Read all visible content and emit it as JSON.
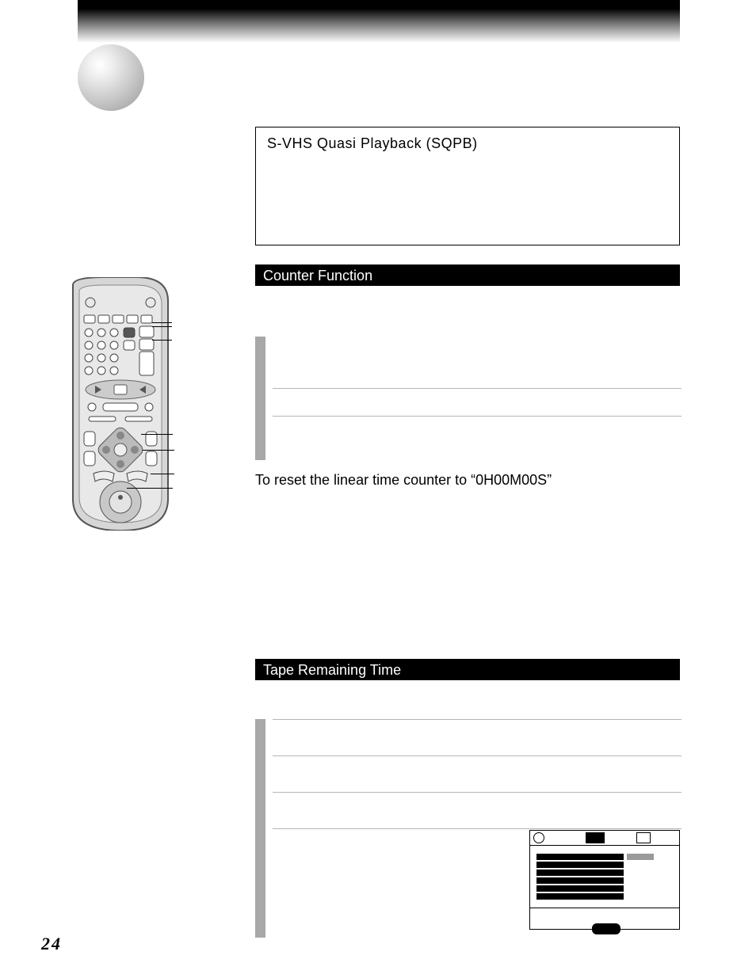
{
  "page_number": "24",
  "svhs": {
    "title": "S-VHS Quasi Playback (SQPB)"
  },
  "sections": {
    "counter": {
      "title": "Counter Function",
      "reset_heading": "To reset the linear time counter to “0H00M00S”"
    },
    "tape_remaining": {
      "title": "Tape Remaining Time"
    }
  },
  "remote": {
    "name": "remote-control-diagram"
  },
  "osd": {
    "name": "menu-screen-illustration"
  }
}
